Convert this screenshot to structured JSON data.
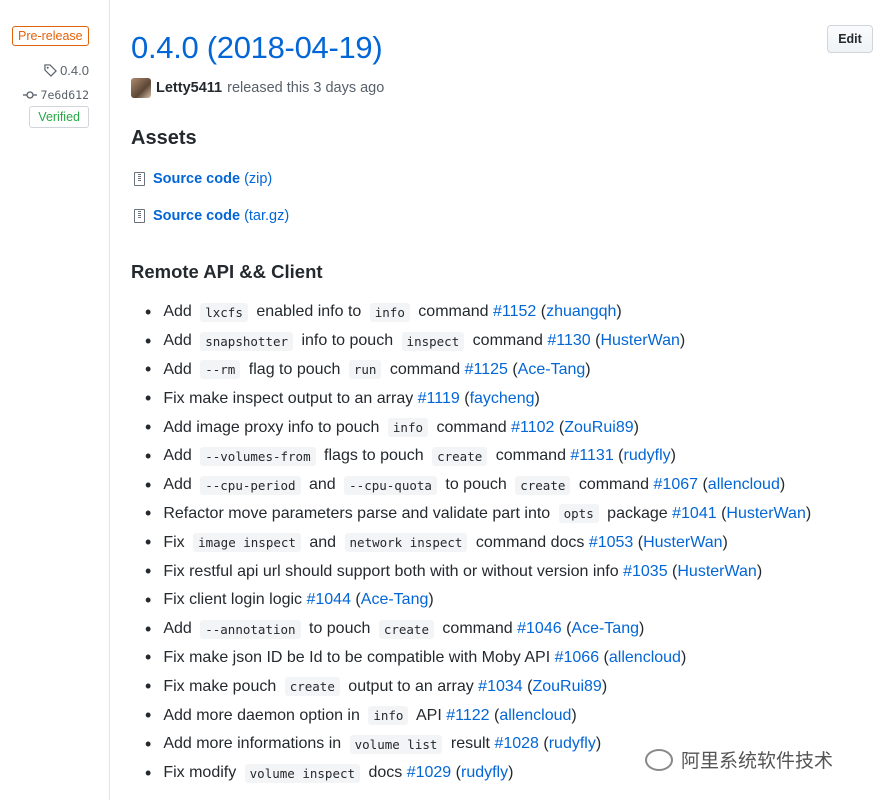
{
  "sidebar": {
    "prerelease_label": "Pre-release",
    "tag": "0.4.0",
    "commit": "7e6d612",
    "verified_label": "Verified"
  },
  "release": {
    "title": "0.4.0 (2018-04-19)",
    "author": "Letty5411",
    "released_text": "released this 3 days ago",
    "edit_label": "Edit"
  },
  "assets": {
    "heading": "Assets",
    "items": [
      {
        "name": "Source code",
        "format": "(zip)"
      },
      {
        "name": "Source code",
        "format": "(tar.gz)"
      }
    ]
  },
  "section": {
    "heading": "Remote API && Client"
  },
  "changes": [
    [
      {
        "t": "Add "
      },
      {
        "c": "lxcfs"
      },
      {
        "t": " enabled info to "
      },
      {
        "c": "info"
      },
      {
        "t": " command "
      },
      {
        "l": "#1152"
      },
      {
        "t": " ("
      },
      {
        "l": "zhuangqh"
      },
      {
        "t": ")"
      }
    ],
    [
      {
        "t": "Add "
      },
      {
        "c": "snapshotter"
      },
      {
        "t": " info to pouch "
      },
      {
        "c": "inspect"
      },
      {
        "t": " command "
      },
      {
        "l": "#1130"
      },
      {
        "t": " ("
      },
      {
        "l": "HusterWan"
      },
      {
        "t": ")"
      }
    ],
    [
      {
        "t": "Add "
      },
      {
        "c": "--rm"
      },
      {
        "t": " flag to pouch "
      },
      {
        "c": "run"
      },
      {
        "t": " command "
      },
      {
        "l": "#1125"
      },
      {
        "t": " ("
      },
      {
        "l": "Ace-Tang"
      },
      {
        "t": ")"
      }
    ],
    [
      {
        "t": "Fix make inspect output to an array "
      },
      {
        "l": "#1119"
      },
      {
        "t": " ("
      },
      {
        "l": "faycheng"
      },
      {
        "t": ")"
      }
    ],
    [
      {
        "t": "Add image proxy info to pouch "
      },
      {
        "c": "info"
      },
      {
        "t": " command "
      },
      {
        "l": "#1102"
      },
      {
        "t": " ("
      },
      {
        "l": "ZouRui89"
      },
      {
        "t": ")"
      }
    ],
    [
      {
        "t": "Add "
      },
      {
        "c": "--volumes-from"
      },
      {
        "t": " flags to pouch "
      },
      {
        "c": "create"
      },
      {
        "t": " command "
      },
      {
        "l": "#1131"
      },
      {
        "t": " ("
      },
      {
        "l": "rudyfly"
      },
      {
        "t": ")"
      }
    ],
    [
      {
        "t": "Add "
      },
      {
        "c": "--cpu-period"
      },
      {
        "t": " and "
      },
      {
        "c": "--cpu-quota"
      },
      {
        "t": " to pouch "
      },
      {
        "c": "create"
      },
      {
        "t": " command "
      },
      {
        "l": "#1067"
      },
      {
        "t": " ("
      },
      {
        "l": "allencloud"
      },
      {
        "t": ")"
      }
    ],
    [
      {
        "t": "Refactor move parameters parse and validate part into "
      },
      {
        "c": "opts"
      },
      {
        "t": " package "
      },
      {
        "l": "#1041"
      },
      {
        "t": " ("
      },
      {
        "l": "HusterWan"
      },
      {
        "t": ")"
      }
    ],
    [
      {
        "t": "Fix "
      },
      {
        "c": "image inspect"
      },
      {
        "t": " and "
      },
      {
        "c": "network inspect"
      },
      {
        "t": " command docs "
      },
      {
        "l": "#1053"
      },
      {
        "t": " ("
      },
      {
        "l": "HusterWan"
      },
      {
        "t": ")"
      }
    ],
    [
      {
        "t": "Fix restful api url should support both with or without version info "
      },
      {
        "l": "#1035"
      },
      {
        "t": " ("
      },
      {
        "l": "HusterWan"
      },
      {
        "t": ")"
      }
    ],
    [
      {
        "t": "Fix client login logic "
      },
      {
        "l": "#1044"
      },
      {
        "t": " ("
      },
      {
        "l": "Ace-Tang"
      },
      {
        "t": ")"
      }
    ],
    [
      {
        "t": "Add "
      },
      {
        "c": "--annotation"
      },
      {
        "t": " to pouch "
      },
      {
        "c": "create"
      },
      {
        "t": " command "
      },
      {
        "l": "#1046"
      },
      {
        "t": " ("
      },
      {
        "l": "Ace-Tang"
      },
      {
        "t": ")"
      }
    ],
    [
      {
        "t": "Fix make json ID be Id to be compatible with Moby API "
      },
      {
        "l": "#1066"
      },
      {
        "t": " ("
      },
      {
        "l": "allencloud"
      },
      {
        "t": ")"
      }
    ],
    [
      {
        "t": "Fix make pouch "
      },
      {
        "c": "create"
      },
      {
        "t": " output to an array "
      },
      {
        "l": "#1034"
      },
      {
        "t": " ("
      },
      {
        "l": "ZouRui89"
      },
      {
        "t": ")"
      }
    ],
    [
      {
        "t": "Add more daemon option in "
      },
      {
        "c": "info"
      },
      {
        "t": " API "
      },
      {
        "l": "#1122"
      },
      {
        "t": " ("
      },
      {
        "l": "allencloud"
      },
      {
        "t": ")"
      }
    ],
    [
      {
        "t": "Add more informations in "
      },
      {
        "c": "volume list"
      },
      {
        "t": " result "
      },
      {
        "l": "#1028"
      },
      {
        "t": " ("
      },
      {
        "l": "rudyfly"
      },
      {
        "t": ")"
      }
    ],
    [
      {
        "t": "Fix modify "
      },
      {
        "c": "volume inspect"
      },
      {
        "t": " docs "
      },
      {
        "l": "#1029"
      },
      {
        "t": " ("
      },
      {
        "l": "rudyfly"
      },
      {
        "t": ")"
      }
    ]
  ],
  "watermark": {
    "text": "阿里系统软件技术"
  },
  "colors": {
    "link": "#0366d6",
    "prerelease": "#e36209",
    "verified": "#28a745"
  }
}
